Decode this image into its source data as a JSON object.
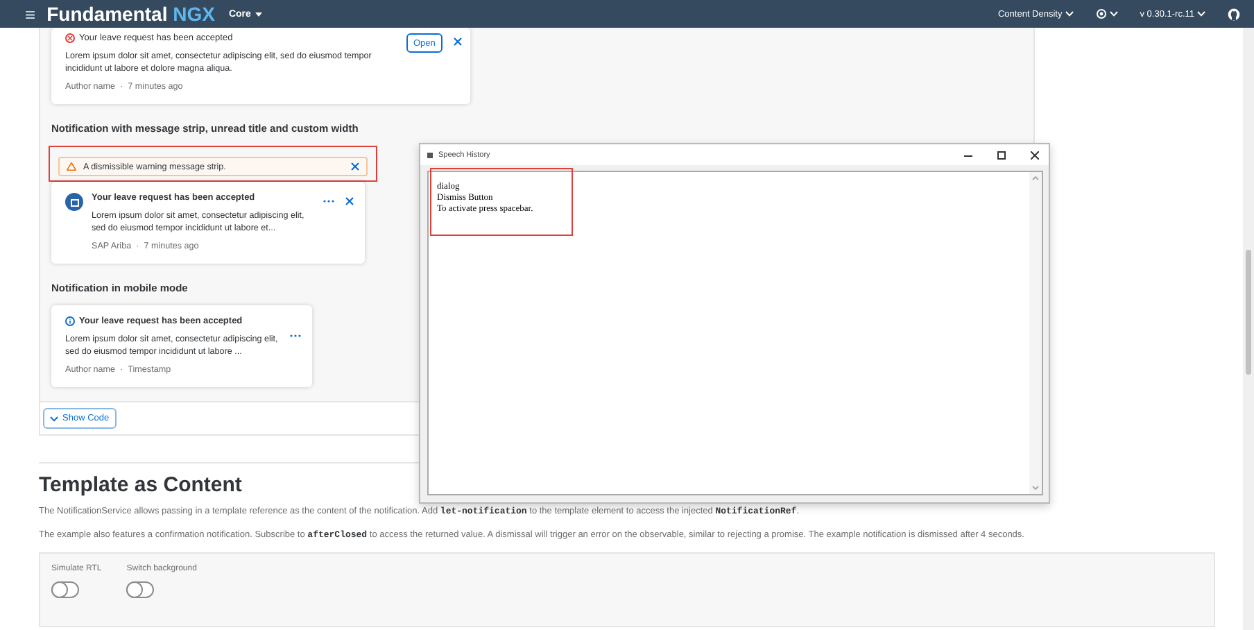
{
  "header": {
    "menu_icon": "≡",
    "brand": "Fundamental",
    "brand_accent": "NGX",
    "product": "Core",
    "right": [
      {
        "kind": "text",
        "label": "Content Density"
      },
      {
        "kind": "theme"
      },
      {
        "kind": "text",
        "label": "v 0.30.1-rc.11"
      },
      {
        "kind": "github"
      }
    ]
  },
  "example": {
    "notification_1": {
      "title": "Your leave request has been accepted",
      "action": "Open",
      "body": "Lorem ipsum dolor sit amet, consectetur adipiscing elit, sed do eiusmod tempor incididunt ut labore et dolore magna aliqua.",
      "author": "Author name",
      "separator": "·",
      "time": "7 minutes ago"
    },
    "section_2_title": "Notification with message strip, unread title and custom width",
    "message_strip": {
      "text": "A dismissible warning message strip.",
      "highlighted": true
    },
    "notification_2": {
      "title": "Your leave request has been accepted",
      "body": "Lorem ipsum dolor sit amet, consectetur adipiscing elit, sed do eiusmod tempor incididunt ut labore et...",
      "author": "SAP Ariba",
      "separator": "·",
      "time": "7 minutes ago"
    },
    "section_3_title": "Notification in mobile mode",
    "notification_3": {
      "title": "Your leave request has been accepted",
      "body": "Lorem ipsum dolor sit amet, consectetur adipiscing elit, sed do eiusmod tempor incididunt ut labore ...",
      "author": "Author name",
      "separator": "·",
      "time": "Timestamp"
    },
    "show_code": "Show Code"
  },
  "template_section": {
    "title": "Template as Content",
    "paragraphs": [
      [
        {
          "text": "The NotificationService allows passing in a template reference as the content of the notification. Add ",
          "code": false
        },
        {
          "text": "let-notification",
          "code": true
        },
        {
          "text": " to the template element to access the injected ",
          "code": false
        },
        {
          "text": "NotificationRef",
          "code": true
        },
        {
          "text": ".",
          "code": false
        }
      ],
      [
        {
          "text": "The example also features a confirmation notification. Subscribe to ",
          "code": false
        },
        {
          "text": "afterClosed",
          "code": true
        },
        {
          "text": " to access the returned value. A dismissal will trigger an error on the observable, similar to rejecting a promise. The example notification is dismissed after 4 seconds.",
          "code": false
        }
      ]
    ],
    "switches": [
      {
        "label": "Simulate RTL",
        "on": false
      },
      {
        "label": "Switch background",
        "on": false
      }
    ]
  },
  "speech_history": {
    "title": "Speech History",
    "lines": [
      "dialog",
      "Dismiss Button",
      "To activate press spacebar."
    ],
    "highlighted": true
  }
}
